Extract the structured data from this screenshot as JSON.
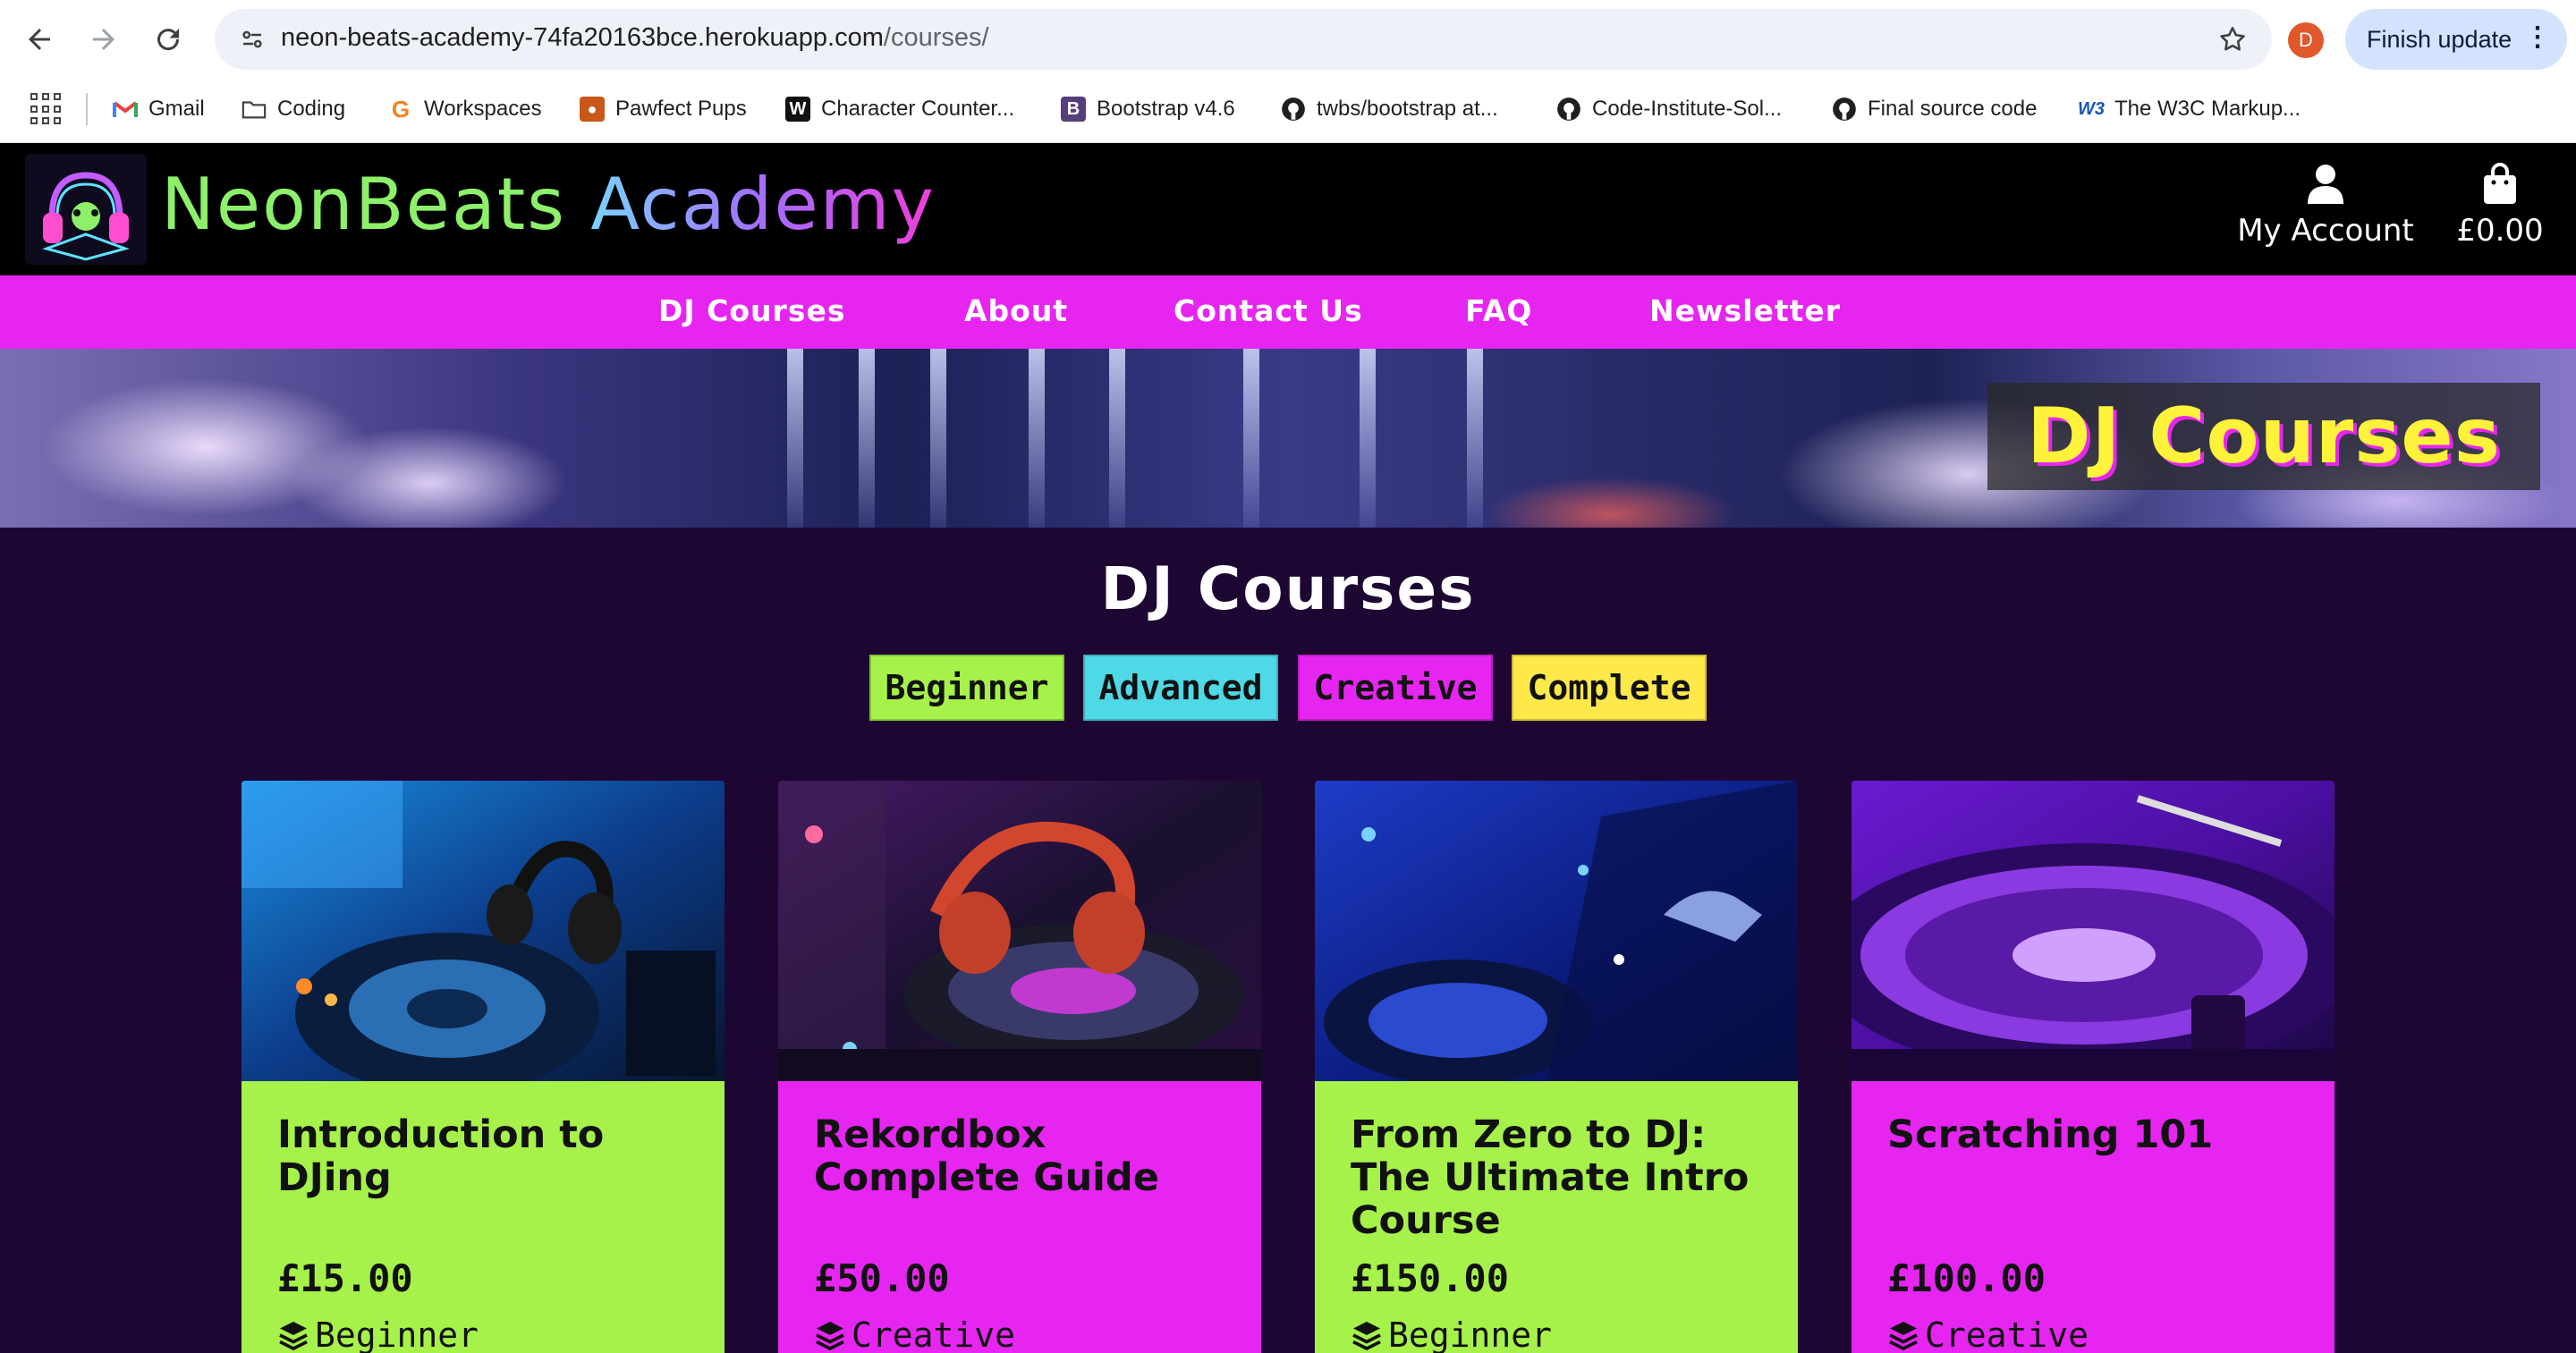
{
  "browser": {
    "url_host": "neon-beats-academy-74fa20163bce.herokuapp.com",
    "url_path": "/courses/",
    "profile_initial": "D",
    "finish_update_label": "Finish update",
    "bookmarks": [
      {
        "label": "Gmail",
        "icon": "gmail-icon"
      },
      {
        "label": "Coding",
        "icon": "folder-icon"
      },
      {
        "label": "Workspaces",
        "icon": "workspaces-icon"
      },
      {
        "label": "Pawfect Pups",
        "icon": "paw-icon"
      },
      {
        "label": "Character Counter...",
        "icon": "w-icon"
      },
      {
        "label": "Bootstrap v4.6",
        "icon": "bootstrap-icon"
      },
      {
        "label": "twbs/bootstrap at...",
        "icon": "github-icon"
      },
      {
        "label": "Code-Institute-Sol...",
        "icon": "github-icon"
      },
      {
        "label": "Final source code",
        "icon": "github-icon"
      },
      {
        "label": "The W3C Markup...",
        "icon": "w3c-icon"
      }
    ]
  },
  "header": {
    "brand_part1": "NeonBeats",
    "brand_part2": "Academy",
    "account_label": "My Account",
    "cart_total": "£0.00"
  },
  "nav": {
    "items": [
      "DJ Courses",
      "About",
      "Contact Us",
      "FAQ",
      "Newsletter"
    ]
  },
  "hero": {
    "title": "DJ Courses"
  },
  "main": {
    "title": "DJ Courses",
    "filters": [
      {
        "label": "Beginner",
        "color": "#a6f24a"
      },
      {
        "label": "Advanced",
        "color": "#4fd8e6"
      },
      {
        "label": "Creative",
        "color": "#e626f0"
      },
      {
        "label": "Complete",
        "color": "#ffe84a"
      }
    ],
    "courses": [
      {
        "title": "Introduction to DJing",
        "price": "£15.00",
        "level": "Beginner",
        "color": "#a6f24a"
      },
      {
        "title": "Rekordbox Complete Guide",
        "price": "£50.00",
        "level": "Creative",
        "color": "#e626f0"
      },
      {
        "title": "From Zero to DJ: The Ultimate Intro Course",
        "price": "£150.00",
        "level": "Beginner",
        "color": "#a6f24a"
      },
      {
        "title": "Scratching 101",
        "price": "£100.00",
        "level": "Creative",
        "color": "#e626f0"
      }
    ]
  }
}
